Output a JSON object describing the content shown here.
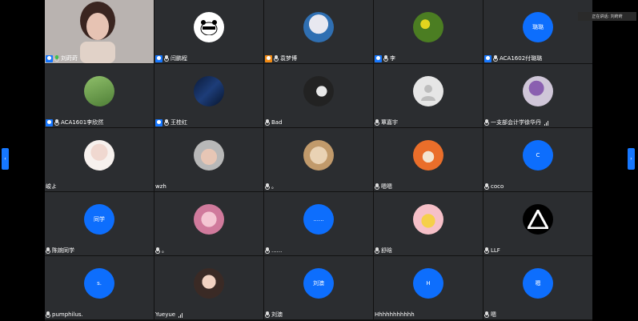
{
  "speaking_indicator": "正在讲话: 刘莳莳",
  "nav": {
    "prev_glyph": "‹",
    "next_glyph": "›"
  },
  "participants": [
    {
      "name": "刘莳莳",
      "type": "video",
      "badge": "host",
      "mic": "active"
    },
    {
      "name": "闫鹏程",
      "type": "image",
      "icon": "panda-avatar-icon",
      "badge": "host"
    },
    {
      "name": "袁梦博",
      "type": "image",
      "icon": "cartoon-avatar-icon",
      "badge": "host-orange"
    },
    {
      "name": "李",
      "type": "image",
      "icon": "flowers-avatar-icon",
      "badge": "host"
    },
    {
      "name": "ACA1602付璐璐",
      "type": "letter",
      "text": "璐璐",
      "badge": "host"
    },
    {
      "name": "ACA1601李欣然",
      "type": "image",
      "icon": "grass-avatar-icon",
      "badge": "host"
    },
    {
      "name": "王桂红",
      "type": "image",
      "icon": "night-sky-avatar-icon",
      "badge": "host"
    },
    {
      "name": "Bad",
      "type": "image",
      "icon": "dark-photo-avatar-icon"
    },
    {
      "name": "覃嘉宇",
      "type": "image",
      "icon": "default-person-avatar-icon"
    },
    {
      "name": "一支部会计学徐华丹",
      "type": "image",
      "icon": "person-photo-avatar-icon",
      "signal": true
    },
    {
      "name": "峻よ",
      "type": "image",
      "icon": "anime-avatar-icon",
      "nomic": true
    },
    {
      "name": "wzh",
      "type": "image",
      "icon": "portrait-avatar-icon",
      "nomic": true
    },
    {
      "name": "。",
      "type": "image",
      "icon": "cat-avatar-icon"
    },
    {
      "name": "嗯嗯",
      "type": "image",
      "icon": "cartoon-orange-avatar-icon"
    },
    {
      "name": "coco",
      "type": "letter",
      "text": "C"
    },
    {
      "name": "陈婉同学",
      "type": "letter",
      "text": "同学"
    },
    {
      "name": "。",
      "type": "image",
      "icon": "pink-hair-avatar-icon"
    },
    {
      "name": "......",
      "type": "letter",
      "text": "......"
    },
    {
      "name": "舒晗",
      "type": "image",
      "icon": "yellow-cartoon-avatar-icon"
    },
    {
      "name": "LLF",
      "type": "image",
      "icon": "triangle-logo-avatar-icon"
    },
    {
      "name": "pumphilus.",
      "type": "letter",
      "text": "s."
    },
    {
      "name": "Yueyue",
      "type": "image",
      "icon": "woman-portrait-avatar-icon",
      "signal": true,
      "nomic": true
    },
    {
      "name": "刘澳",
      "type": "letter",
      "text": "刘澳"
    },
    {
      "name": "Hhhhhhhhhhh",
      "type": "letter",
      "text": "H",
      "nomic": true
    },
    {
      "name": "嗯",
      "type": "letter",
      "text": "嗯"
    }
  ]
}
